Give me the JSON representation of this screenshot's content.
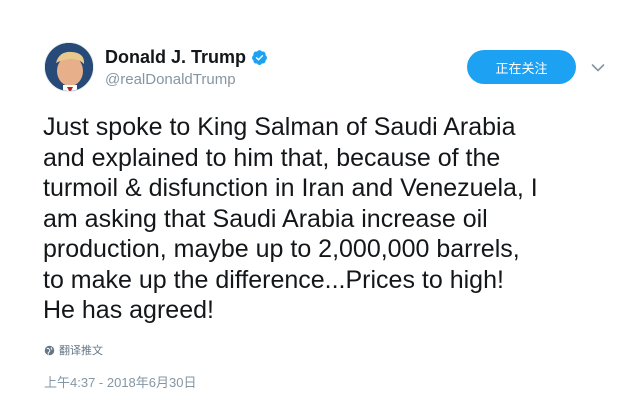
{
  "author": {
    "display_name": "Donald J. Trump",
    "handle": "@realDonaldTrump",
    "verified": true
  },
  "follow_button": {
    "label": "正在关注"
  },
  "tweet": {
    "lines": [
      "Just spoke to King Salman of Saudi Arabia",
      "and explained to him that, because of the",
      "turmoil & disfunction in Iran and Venezuela, I",
      "am asking that Saudi Arabia increase oil",
      "production, maybe up to 2,000,000 barrels,",
      "to make up the difference...Prices to high!",
      "He has agreed!"
    ]
  },
  "translate": {
    "label": "翻译推文",
    "icon": "globe-icon"
  },
  "timestamp": "上午4:37 - 2018年6月30日",
  "colors": {
    "accent": "#1da1f2",
    "secondary_text": "#8596a3"
  }
}
